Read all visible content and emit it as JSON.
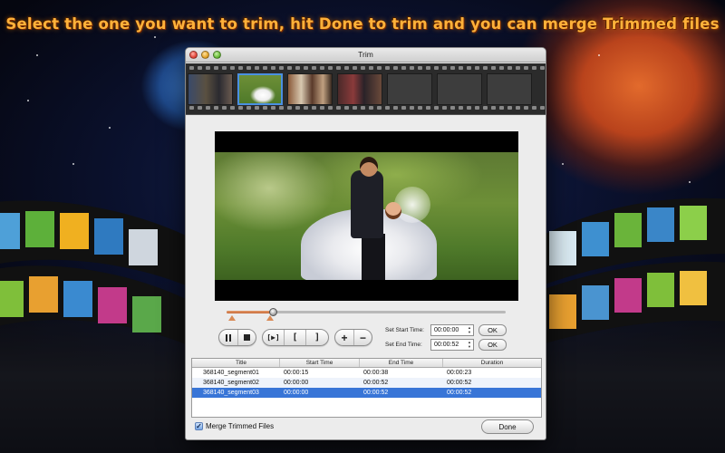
{
  "headline": "Select the one you want to trim, hit Done to trim and you can merge Trimmed files",
  "window": {
    "title": "Trim"
  },
  "thumbnails": [
    {
      "label": "clip-1",
      "filled": true
    },
    {
      "label": "clip-2",
      "filled": true,
      "selected": true
    },
    {
      "label": "clip-3",
      "filled": true
    },
    {
      "label": "clip-4",
      "filled": true
    },
    {
      "label": "empty",
      "filled": false
    },
    {
      "label": "empty",
      "filled": false
    },
    {
      "label": "empty",
      "filled": false
    }
  ],
  "slider": {
    "position": 0.165,
    "start_marker": 0.02,
    "end_marker": 0.155
  },
  "controls": {
    "pause_icon": "pause-icon",
    "stop_icon": "stop-icon",
    "play_segment_label": "[▶]",
    "mark_in_label": "[",
    "mark_out_label": "]",
    "add_label": "+",
    "remove_label": "−"
  },
  "start_time": {
    "label": "Set Start Time:",
    "value": "00:00:00",
    "ok_label": "OK"
  },
  "end_time": {
    "label": "Set End Time:",
    "value": "00:00:52",
    "ok_label": "OK"
  },
  "table": {
    "headers": [
      "Title",
      "Start Time",
      "End Time",
      "Duration"
    ],
    "rows": [
      [
        "368140_segment01",
        "00:00:15",
        "00:00:38",
        "00:00:23"
      ],
      [
        "368140_segment02",
        "00:00:00",
        "00:00:52",
        "00:00:52"
      ],
      [
        "368140_segment03",
        "00:00:00",
        "00:00:52",
        "00:00:52"
      ]
    ],
    "selected_row": 2
  },
  "merge": {
    "label": "Merge Trimmed Files",
    "checked": true
  },
  "done_label": "Done",
  "colors": {
    "headline": "#ffb23a",
    "selection": "#3875d7",
    "slider_fill": "#c86b3a"
  }
}
